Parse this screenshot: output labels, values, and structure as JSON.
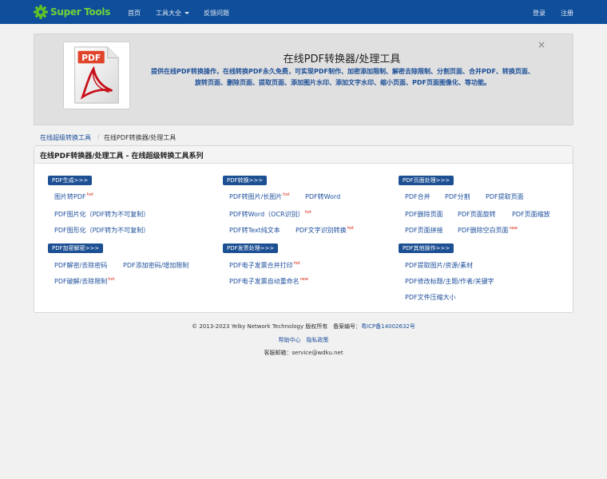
{
  "nav": {
    "brand": "Super Tools",
    "home": "首页",
    "tools": "工具大全",
    "feedback": "反馈问题",
    "login": "登录",
    "register": "注册"
  },
  "hero": {
    "close": "×",
    "title": "在线PDF转换器/处理工具",
    "desc": "提供在线PDF转换操作，在线转换PDF永久免费，可实现PDF制作、加密添加限制、解密去除限制、分割页面、合并PDF、转换页面、旋转页面、删除页面、提取页面、添加图片水印、添加文字水印、缩小页面、PDF页面图像化、等功能。",
    "thumb_label": "PDF"
  },
  "breadcrumb": {
    "parent": "在线超级转换工具",
    "sep": "/",
    "current": "在线PDF转换器/处理工具"
  },
  "panel": {
    "title": "在线PDF转换器/处理工具 - 在线超级转换工具系列"
  },
  "sections": {
    "create": {
      "label": "PDF生成>>>",
      "items": [
        {
          "text": "图片转PDF",
          "badge": "hot"
        },
        {
          "text": "PDF图片化（PDF转为不可复制）",
          "badge": ""
        },
        {
          "text": "PDF图形化（PDF转为不可复制）",
          "badge": ""
        }
      ]
    },
    "convert": {
      "label": "PDF转换>>>",
      "items": [
        {
          "text": "PDF转图片/长图片",
          "badge": "hot"
        },
        {
          "text": "PDF转Word",
          "badge": ""
        },
        {
          "text": "PDF转Word（OCR识别）",
          "badge": "hot"
        },
        {
          "text": "PDF转Text纯文本",
          "badge": ""
        },
        {
          "text": "PDF文字识别转换",
          "badge": "hot"
        }
      ]
    },
    "page": {
      "label": "PDF页面处理>>>",
      "items": [
        {
          "text": "PDF合并",
          "badge": ""
        },
        {
          "text": "PDF分割",
          "badge": ""
        },
        {
          "text": "PDF提取页面",
          "badge": ""
        },
        {
          "text": "PDF删除页面",
          "badge": ""
        },
        {
          "text": "PDF页面旋转",
          "badge": ""
        },
        {
          "text": "PDF页面缩放",
          "badge": ""
        },
        {
          "text": "PDF页面拼接",
          "badge": ""
        },
        {
          "text": "PDF删除空白页面",
          "badge": "new"
        }
      ]
    },
    "crypt": {
      "label": "PDF加密解密>>>",
      "items": [
        {
          "text": "PDF解密/去除密码",
          "badge": ""
        },
        {
          "text": "PDF添加密码/增加限制",
          "badge": ""
        },
        {
          "text": "PDF破解/去除限制",
          "badge": "hot"
        }
      ]
    },
    "invoice": {
      "label": "PDF发票处理>>>",
      "items": [
        {
          "text": "PDF电子发票合并打印",
          "badge": "hot"
        },
        {
          "text": "PDF电子发票自动重命名",
          "badge": "new"
        }
      ]
    },
    "other": {
      "label": "PDF其他操作>>>",
      "items": [
        {
          "text": "PDF提取图片/资源/素材",
          "badge": ""
        },
        {
          "text": "PDF修改标题/主题/作者/关键字",
          "badge": ""
        },
        {
          "text": "PDF文件压缩大小",
          "badge": ""
        }
      ]
    }
  },
  "footer": {
    "copyright": "© 2013-2023 Yelky Network Technology 版权所有",
    "icp_label": "备案编号：",
    "icp": "粤ICP备14002632号",
    "help": "帮助中心",
    "privacy": "隐私政策",
    "email": "客服邮箱：service@wdku.net"
  },
  "colors": {
    "navbar": "#0e4e9a",
    "label_bg": "#1d4f93",
    "link": "#1c4f9c",
    "hot": "#d9230f",
    "brand": "#6fd33a"
  }
}
